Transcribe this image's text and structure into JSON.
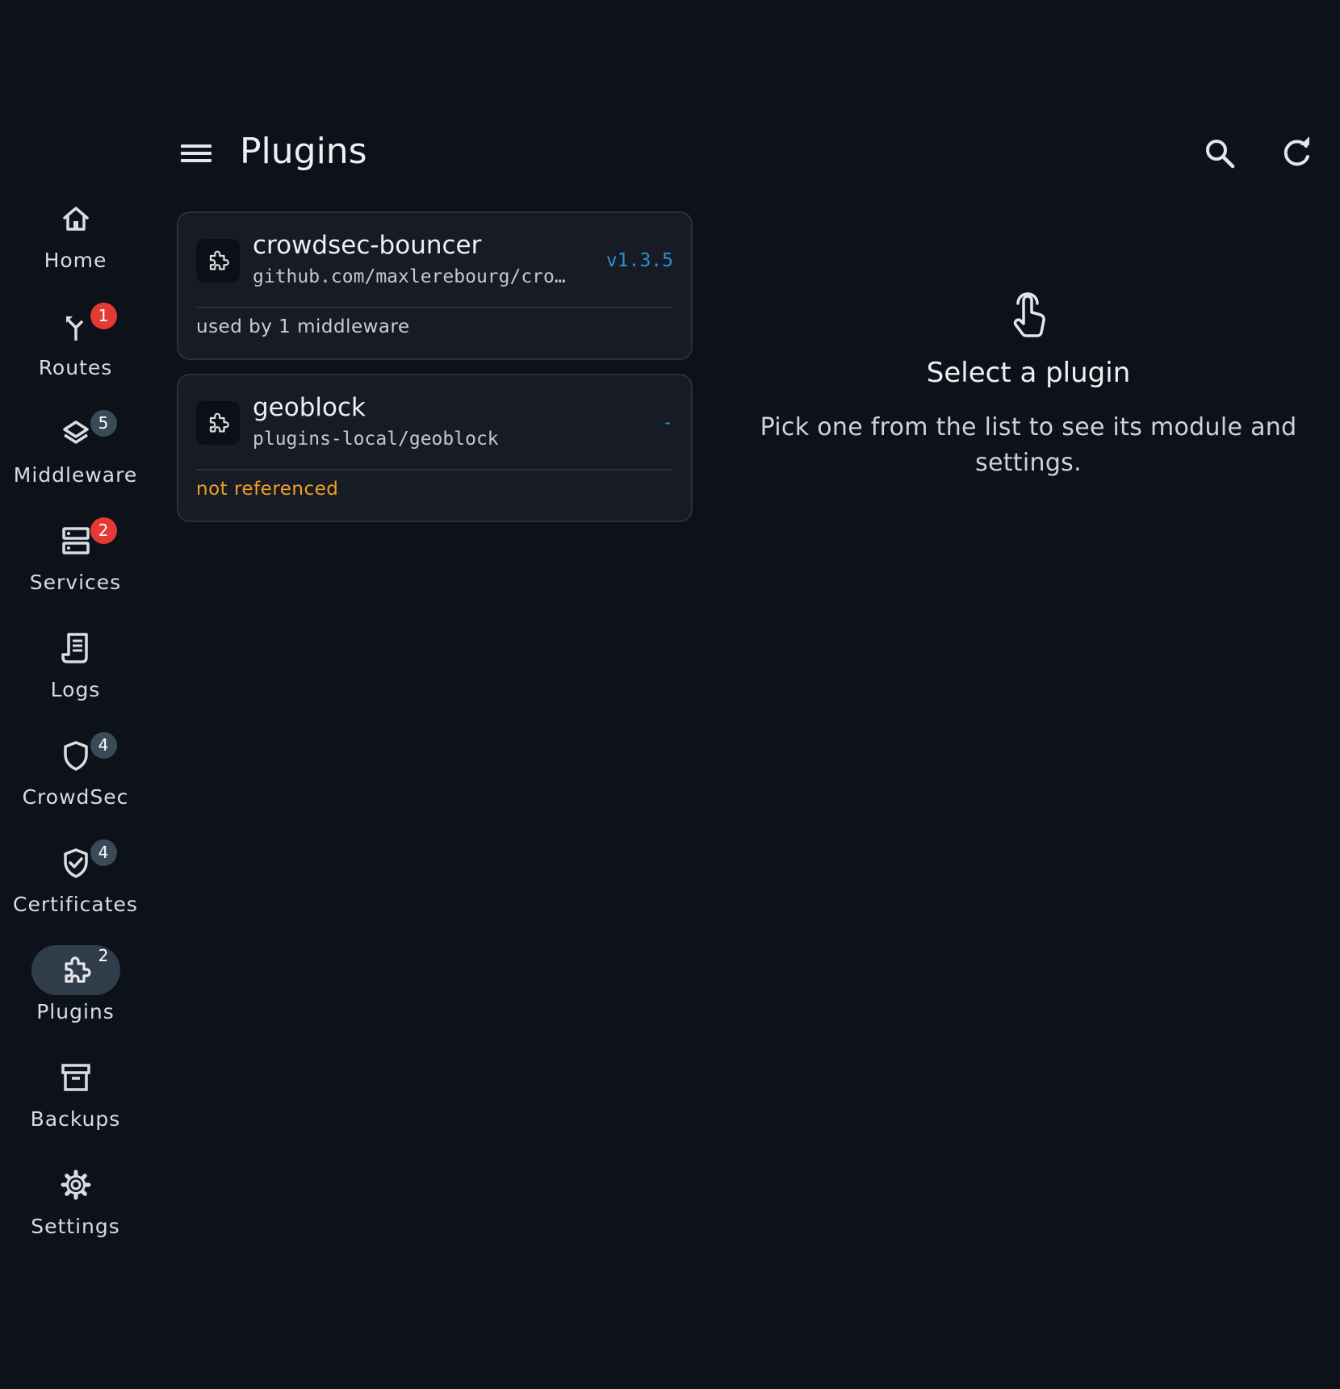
{
  "header": {
    "title": "Plugins",
    "menu_icon": "menu-icon",
    "actions": [
      {
        "name": "search",
        "icon": "search-icon"
      },
      {
        "name": "refresh",
        "icon": "refresh-icon"
      }
    ]
  },
  "nav": {
    "items": [
      {
        "label": "Home",
        "icon": "home-icon",
        "badge": null
      },
      {
        "label": "Routes",
        "icon": "routes-icon",
        "badge": "1",
        "badge_color": "#e53935"
      },
      {
        "label": "Middleware",
        "icon": "layers-icon",
        "badge": "5",
        "badge_color": "#3c4a58"
      },
      {
        "label": "Services",
        "icon": "server-icon",
        "badge": "2",
        "badge_color": "#e53935"
      },
      {
        "label": "Logs",
        "icon": "logs-icon",
        "badge": null
      },
      {
        "label": "CrowdSec",
        "icon": "shield-icon",
        "badge": "4",
        "badge_color": "#3c4a58"
      },
      {
        "label": "Certificates",
        "icon": "shield-check-icon",
        "badge": "4",
        "badge_color": "#3c4a58"
      },
      {
        "label": "Plugins",
        "icon": "puzzle-icon",
        "badge": "2",
        "active": true
      },
      {
        "label": "Backups",
        "icon": "archive-icon",
        "badge": null
      },
      {
        "label": "Settings",
        "icon": "gear-icon",
        "badge": null
      }
    ]
  },
  "plugins": [
    {
      "name": "crowdsec-bouncer",
      "module": "github.com/maxlerebourg/cro…",
      "version": "v1.3.5",
      "usage": "used by 1 middleware",
      "usage_status": "used"
    },
    {
      "name": "geoblock",
      "module": "plugins-local/geoblock",
      "version": "-",
      "usage": "not referenced",
      "usage_status": "unreferenced"
    }
  ],
  "empty_state": {
    "icon": "touch-icon",
    "title": "Select a plugin",
    "text": "Pick one from the list to see its module and settings."
  },
  "colors": {
    "background": "#0d111a",
    "card": "#161b25",
    "accent_version": "#2e8fd0",
    "warning": "#f0a020",
    "badge_red": "#e53935",
    "rail_active": "#2f3d4b"
  }
}
